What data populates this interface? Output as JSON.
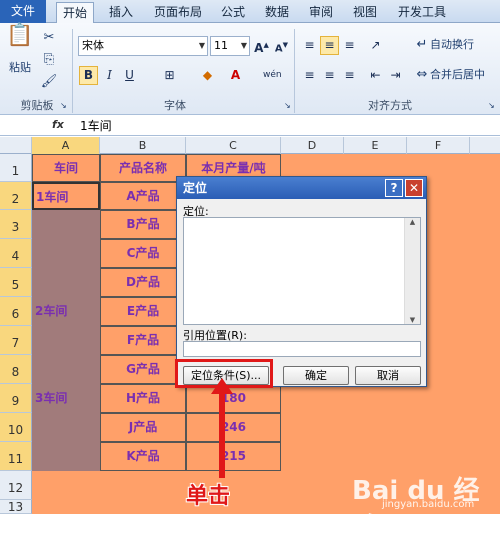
{
  "tabs": [
    "文件",
    "开始",
    "插入",
    "页面布局",
    "公式",
    "数据",
    "审阅",
    "视图",
    "开发工具"
  ],
  "ribbon": {
    "paste_label": "粘贴",
    "font_name": "宋体",
    "font_size": "11",
    "groups": [
      "剪贴板",
      "字体",
      "对齐方式"
    ],
    "wrap_text": "自动换行",
    "merge_center": "合并后居中"
  },
  "formula_bar": {
    "name_box": "A2",
    "fx": "fx",
    "content": "1车间"
  },
  "columns": [
    "A",
    "B",
    "C",
    "D",
    "E",
    "F"
  ],
  "rows": [
    "1",
    "2",
    "3",
    "4",
    "5",
    "6",
    "7",
    "8",
    "9",
    "10",
    "11",
    "12",
    "13"
  ],
  "sheet": {
    "header": [
      "车间",
      "产品名称",
      "本月产量/吨"
    ],
    "workshops": [
      "1车间",
      "2车间",
      "3车间"
    ],
    "products": [
      "A产品",
      "B产品",
      "C产品",
      "D产品",
      "E产品",
      "F产品",
      "G产品",
      "H产品",
      "J产品",
      "K产品"
    ],
    "c_values": [
      "180",
      "246",
      "215"
    ]
  },
  "dialog": {
    "title": "定位",
    "help": "?",
    "close": "✕",
    "goto_label": "定位:",
    "ref_label": "引用位置(R):",
    "special_button": "定位条件(S)...",
    "ok_button": "确定",
    "cancel_button": "取消"
  },
  "annotation": "单击",
  "watermark": "Bai du 经验",
  "watermark_url": "jingyan.baidu.com",
  "colors": {
    "orange": "#ffa069",
    "mauve": "#a17b7b",
    "purple": "#7a2fb0",
    "red": "#e01818"
  }
}
